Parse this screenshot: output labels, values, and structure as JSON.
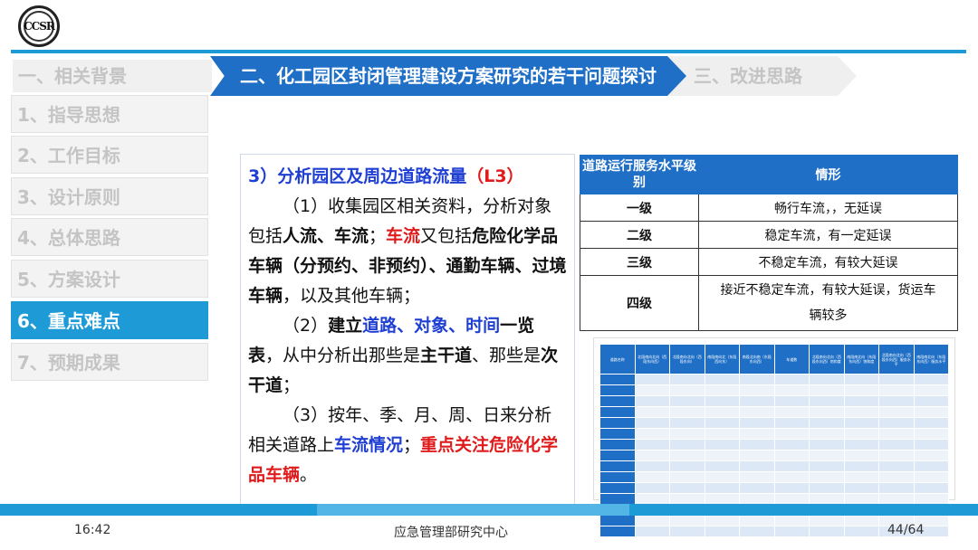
{
  "logo": {
    "text": "CCSR"
  },
  "tabs": [
    {
      "label": "一、相关背景"
    },
    {
      "label": "二、化工园区封闭管理建设方案研究的若干问题探讨"
    },
    {
      "label": "三、改进思路"
    }
  ],
  "sidebar": {
    "items": [
      {
        "label": "1、指导思想"
      },
      {
        "label": "2、工作目标"
      },
      {
        "label": "3、设计原则"
      },
      {
        "label": "4、总体思路"
      },
      {
        "label": "5、方案设计"
      },
      {
        "label": "6、重点难点"
      },
      {
        "label": "7、预期成果"
      }
    ]
  },
  "content": {
    "title": "3）分析园区及周边道路流量",
    "title_code": "（L3）",
    "p1": {
      "a": "（1）收集园区相关资料，分析对象包括",
      "b": "人流、车流",
      "c": "；",
      "d": "车流",
      "e": "又包括",
      "f": "危险化学品车辆（分预约、非预约）、通勤车辆、过境车辆",
      "g": "，以及其他车辆；"
    },
    "p2": {
      "a": "（2）",
      "b": "建立",
      "c": "道路、对象、时间",
      "d": "一览表",
      "e": "，从中分析出那些是",
      "f": "主干道",
      "g": "、那些是",
      "h": "次干道",
      "i": "；"
    },
    "p3": {
      "a": "（3）按年、季、月、周、日来分析相关道路上",
      "b": "车流情况",
      "c": "；",
      "d": "重点关注危险化学品车辆",
      "e": "。"
    }
  },
  "service_table": {
    "headers": [
      "道路运行服务水平级别",
      "情形"
    ],
    "rows": [
      {
        "level": "一级",
        "desc": "畅行车流，，无延误"
      },
      {
        "level": "二级",
        "desc": "稳定车流，有一定延误"
      },
      {
        "level": "三级",
        "desc": "不稳定车流，有较大延误"
      },
      {
        "level": "四级",
        "desc": "接近不稳定车流，有较大延误，货运车辆较多"
      }
    ]
  },
  "flow_table": {
    "headers": [
      "道路名称",
      "北段南向北向（西段东向西）",
      "北段南向北向（西段东向）",
      "南段南向北（东段西向东）",
      "南段北向南（东段东向西）",
      "车道数",
      "北段南向北向（西段东向西）饱和度",
      "南段南北向（东段东向西）饱和度",
      "北段南向北向（西段东向西）服务水平",
      "南段南北向（东段东向西）服务水平"
    ],
    "row_count": 15
  },
  "footer": {
    "time": "16:42",
    "center": "应急管理部研究中心",
    "page": "44/64"
  },
  "colors": {
    "accent": "#1f6fc6",
    "sidebar_active": "#1e9bd7",
    "red": "#e01b1b",
    "blue": "#1f3fd3"
  }
}
